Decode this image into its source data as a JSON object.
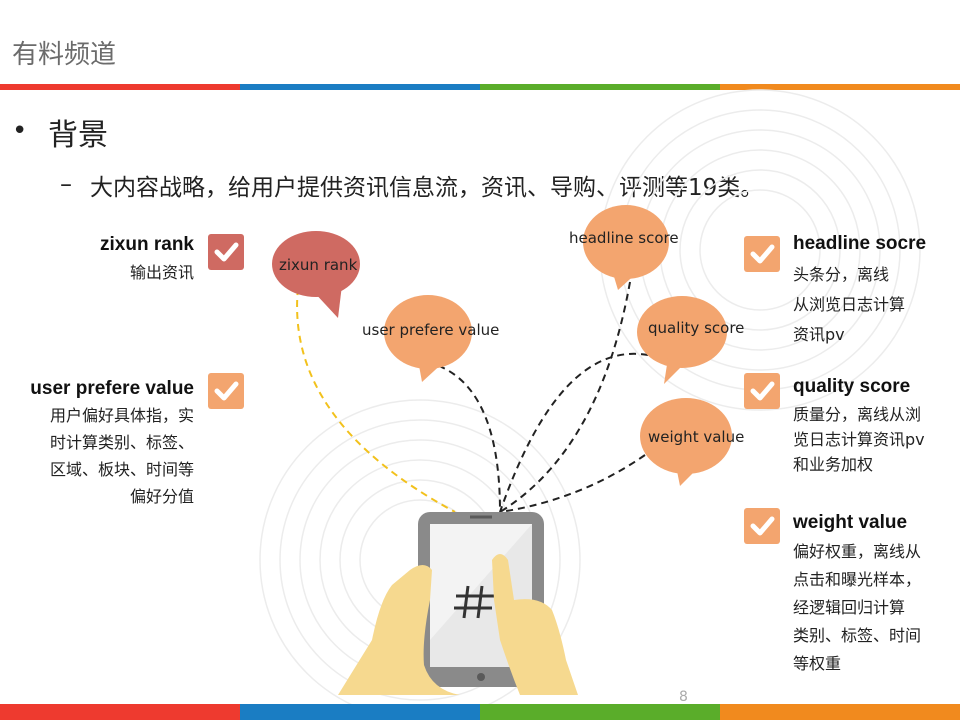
{
  "header": {
    "title": "有料频道"
  },
  "colors": {
    "stripe": [
      "#ee3a2f",
      "#1a7dc3",
      "#5aad2a",
      "#f18a1e"
    ],
    "bubble_orange": "#f3a56f",
    "bubble_red": "#cf6a62",
    "check_red": "#cf6a62",
    "check_orange": "#f3a56f"
  },
  "bullet": {
    "text": "背景",
    "sub": "大内容战略，给用户提供资讯信息流，资讯、导购、评测等19类。"
  },
  "left_items": [
    {
      "title": "zixun rank",
      "desc": [
        "输出资讯"
      ],
      "icon": "check-icon"
    },
    {
      "title": "user prefere value",
      "desc": [
        "用户偏好具体指，实",
        "时计算类别、标签、",
        "区域、板块、时间等",
        "偏好分值"
      ],
      "icon": "check-icon"
    }
  ],
  "right_items": [
    {
      "title": "headline socre",
      "desc": [
        "头条分，离线",
        "从浏览日志计算",
        "资讯pv"
      ],
      "icon": "check-icon"
    },
    {
      "title": "quality  score",
      "desc": [
        "质量分，离线从浏",
        "览日志计算资讯pv",
        "和业务加权"
      ],
      "icon": "check-icon"
    },
    {
      "title": "weight  value",
      "desc": [
        "偏好权重，离线从",
        "点击和曝光样本，",
        "经逻辑回归计算",
        "类别、标签、时间",
        "等权重"
      ],
      "icon": "check-icon"
    }
  ],
  "bubbles": {
    "zixun": "zixun rank",
    "user": "user prefere value",
    "headline": "headline score",
    "quality": "quality score",
    "weight": "weight value"
  },
  "illustration": {
    "icon": "hand-holding-tablet-icon",
    "screen_symbol": "#"
  },
  "footer": {
    "page": "8"
  }
}
